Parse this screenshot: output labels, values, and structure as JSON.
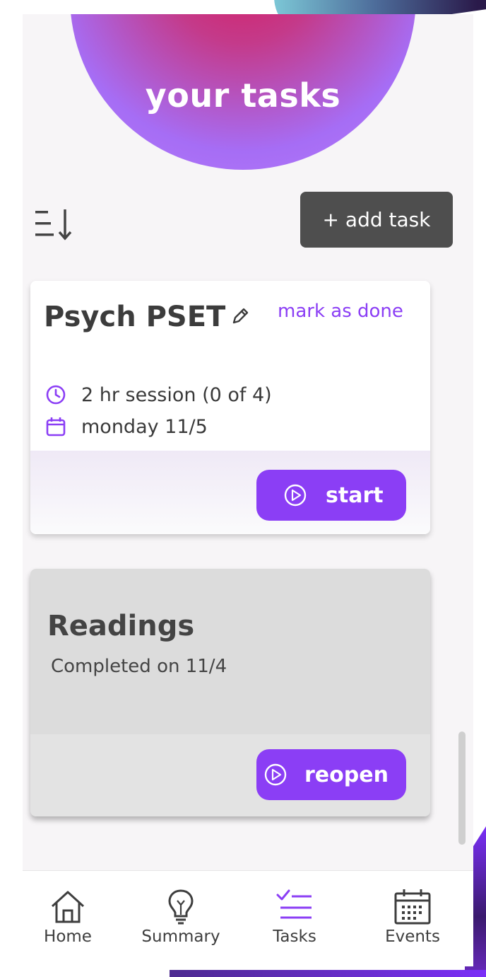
{
  "header": {
    "title": "your tasks"
  },
  "toolbar": {
    "add_task_label": "+ add task",
    "sort_icon": "sort-descending-icon"
  },
  "tasks": [
    {
      "title": "Psych PSET",
      "mark_done_label": "mark as done",
      "session_text": "2 hr session (0 of 4)",
      "date_text": "monday 11/5",
      "action_label": "start"
    },
    {
      "title": "Readings",
      "completed_text": "Completed on 11/4",
      "action_label": "reopen"
    }
  ],
  "nav": {
    "items": [
      {
        "label": "Home",
        "icon": "home-icon"
      },
      {
        "label": "Summary",
        "icon": "lightbulb-icon"
      },
      {
        "label": "Tasks",
        "icon": "checklist-icon",
        "active": true
      },
      {
        "label": "Events",
        "icon": "calendar-icon"
      }
    ]
  },
  "colors": {
    "accent": "#8b3ef5",
    "header_gradient_center": "#d81b60",
    "header_gradient_edge": "#b67cf8",
    "button_dark": "#4e4e4e",
    "completed_card": "#dcdcdc"
  }
}
